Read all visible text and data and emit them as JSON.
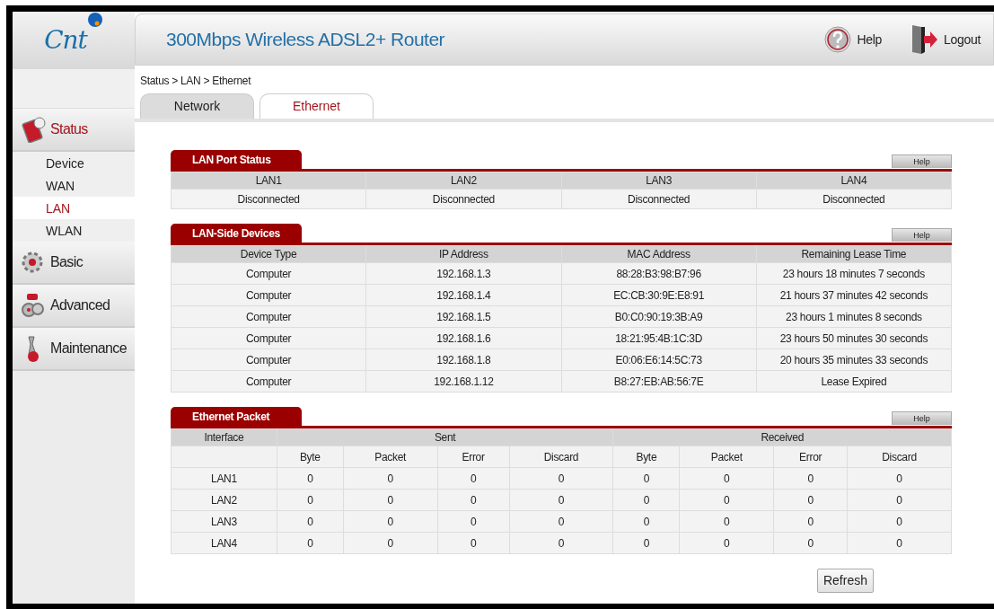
{
  "logo": {
    "text": "Cnt"
  },
  "header": {
    "title": "300Mbps Wireless ADSL2+ Router",
    "help": "Help",
    "logout": "Logout"
  },
  "sidebar": {
    "groups": [
      {
        "label": "Status",
        "selected": true,
        "items": [
          {
            "label": "Device",
            "selected": false
          },
          {
            "label": "WAN",
            "selected": false
          },
          {
            "label": "LAN",
            "selected": true
          },
          {
            "label": "WLAN",
            "selected": false
          }
        ]
      },
      {
        "label": "Basic",
        "selected": false
      },
      {
        "label": "Advanced",
        "selected": false
      },
      {
        "label": "Maintenance",
        "selected": false
      }
    ]
  },
  "breadcrumb": "Status > LAN > Ethernet",
  "tabs": [
    {
      "label": "Network",
      "selected": false
    },
    {
      "label": "Ethernet",
      "selected": true
    }
  ],
  "sections": [
    {
      "kind": "simple",
      "title": "LAN Port Status",
      "help": "Help",
      "columns": [
        "LAN1",
        "LAN2",
        "LAN3",
        "LAN4"
      ],
      "rows": [
        [
          "Disconnected",
          "Disconnected",
          "Disconnected",
          "Disconnected"
        ]
      ]
    },
    {
      "kind": "simple",
      "title": "LAN-Side Devices",
      "help": "Help",
      "columns": [
        "Device Type",
        "IP Address",
        "MAC Address",
        "Remaining Lease Time"
      ],
      "rows": [
        [
          "Computer",
          "192.168.1.3",
          "88:28:B3:98:B7:96",
          "23 hours 18 minutes 7 seconds"
        ],
        [
          "Computer",
          "192.168.1.4",
          "EC:CB:30:9E:E8:91",
          "21 hours 37 minutes 42 seconds"
        ],
        [
          "Computer",
          "192.168.1.5",
          "B0:C0:90:19:3B:A9",
          "23 hours 1 minutes 8 seconds"
        ],
        [
          "Computer",
          "192.168.1.6",
          "18:21:95:4B:1C:3D",
          "23 hours 50 minutes 30 seconds"
        ],
        [
          "Computer",
          "192.168.1.8",
          "E0:06:E6:14:5C:73",
          "20 hours 35 minutes 33 seconds"
        ],
        [
          "Computer",
          "192.168.1.12",
          "B8:27:EB:AB:56:7E",
          "Lease Expired"
        ]
      ]
    },
    {
      "kind": "packet",
      "title": "Ethernet Packet",
      "help": "Help",
      "first_column": "Interface",
      "groups": [
        {
          "label": "Sent",
          "columns": [
            "Byte",
            "Packet",
            "Error",
            "Discard"
          ]
        },
        {
          "label": "Received",
          "columns": [
            "Byte",
            "Packet",
            "Error",
            "Discard"
          ]
        }
      ],
      "rows": [
        [
          "LAN1",
          "0",
          "0",
          "0",
          "0",
          "0",
          "0",
          "0",
          "0"
        ],
        [
          "LAN2",
          "0",
          "0",
          "0",
          "0",
          "0",
          "0",
          "0",
          "0"
        ],
        [
          "LAN3",
          "0",
          "0",
          "0",
          "0",
          "0",
          "0",
          "0",
          "0"
        ],
        [
          "LAN4",
          "0",
          "0",
          "0",
          "0",
          "0",
          "0",
          "0",
          "0"
        ]
      ]
    }
  ],
  "refresh": "Refresh"
}
